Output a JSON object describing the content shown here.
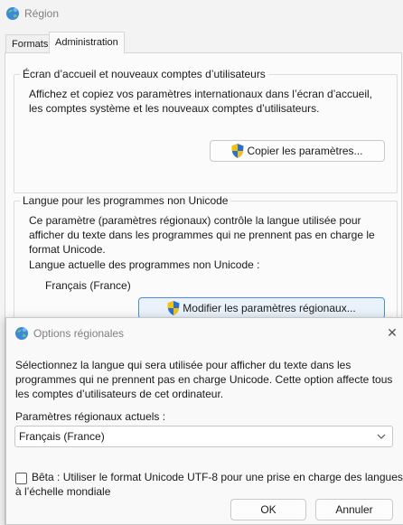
{
  "window": {
    "title": "Région",
    "icon": "globe-icon"
  },
  "tabs": [
    {
      "label": "Formats",
      "active": false
    },
    {
      "label": "Administration",
      "active": true
    }
  ],
  "welcome_section": {
    "title": "Écran d’accueil et nouveaux comptes d’utilisateurs",
    "description_line1": "Affichez et copiez vos paramètres internationaux dans l’écran d’accueil,",
    "description_line2": "les comptes système et les nouveaux comptes d’utilisateurs.",
    "copy_button": "Copier les paramètres..."
  },
  "unicode_section": {
    "title": "Langue pour les programmes non Unicode",
    "description_line1": "Ce paramètre (paramètres régionaux) contrôle la langue utilisée pour",
    "description_line2": "afficher du texte dans les programmes qui ne prennent pas en charge le",
    "description_line3": "format Unicode.",
    "current_label": "Langue actuelle des programmes non Unicode :",
    "current_value": "Français (France)",
    "change_button": "Modifier les paramètres régionaux..."
  },
  "dialog": {
    "title": "Options régionales",
    "close_glyph": "✕",
    "description_line1": "Sélectionnez la langue qui sera utilisée pour afficher du texte dans les",
    "description_line2": "programmes qui ne prennent pas en charge Unicode. Cette option affecte tous",
    "description_line3": "les comptes d’utilisateurs de cet ordinateur.",
    "locale_label": "Paramètres régionaux actuels :",
    "locale_selected": "Français (France)",
    "beta_line1": "Bêta : Utiliser le format Unicode UTF-8 pour une prise en charge des langues",
    "beta_line2": "à l’échelle mondiale",
    "beta_checked": false,
    "ok_button": "OK",
    "cancel_button": "Annuler"
  },
  "colors": {
    "accent": "#4a8fd8",
    "shield_blue": "#2a6fd1",
    "shield_yellow": "#f4c20d"
  }
}
